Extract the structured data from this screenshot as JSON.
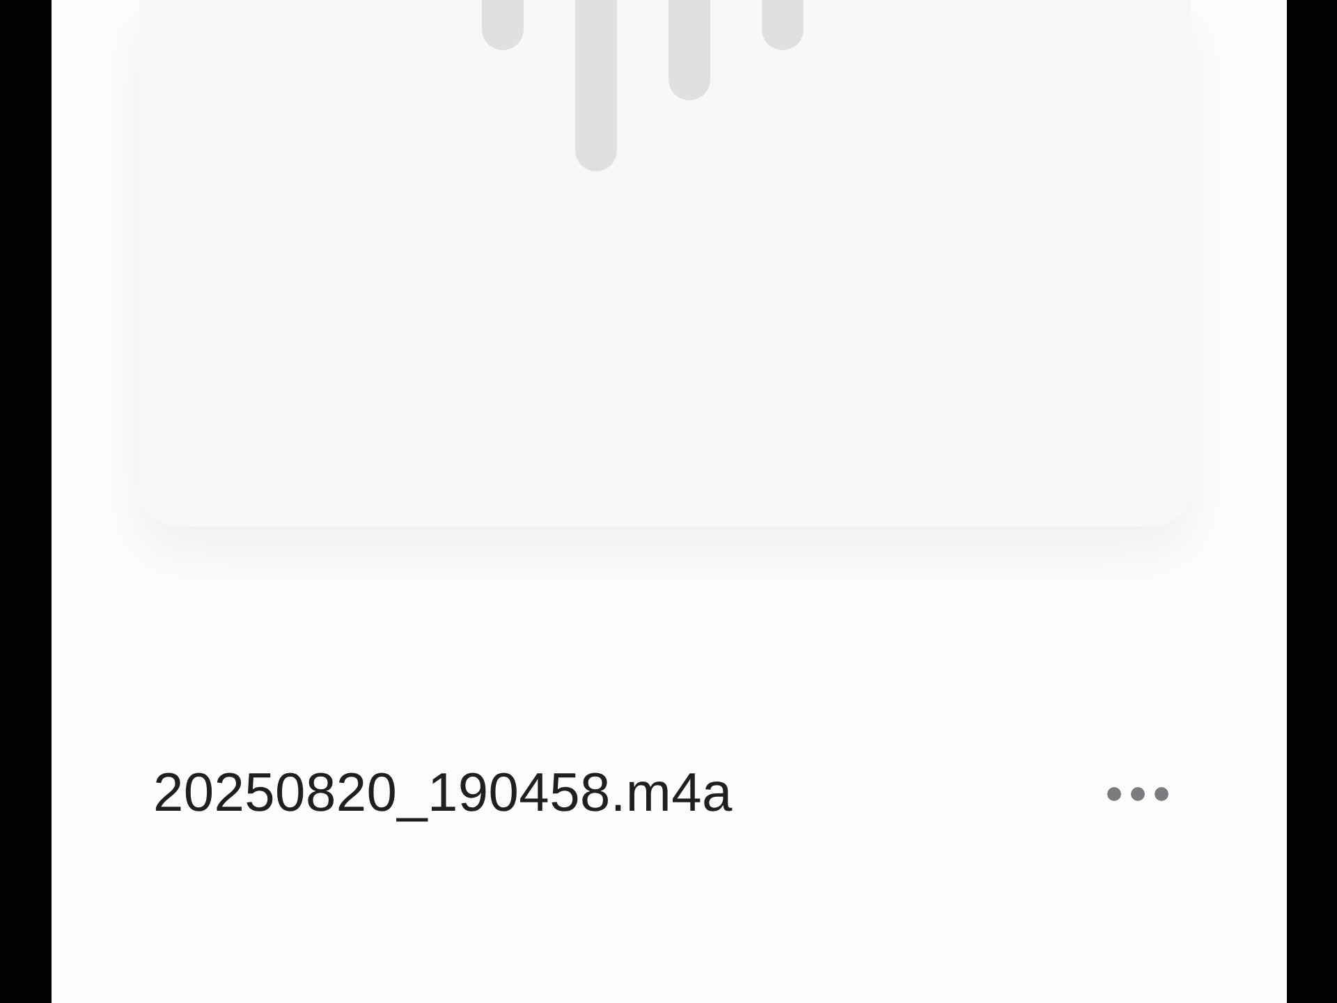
{
  "file": {
    "name": "20250820_190458.m4a"
  }
}
